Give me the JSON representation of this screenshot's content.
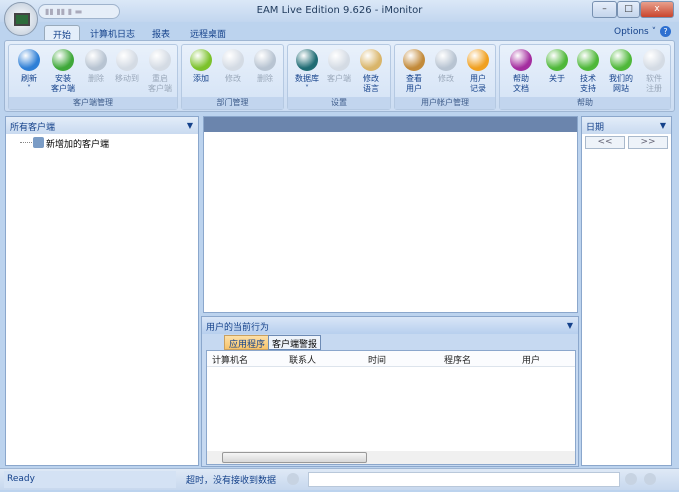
{
  "window": {
    "title": "EAM Live Edition 9.626 - iMonitor",
    "minimize": "–",
    "maximize": "□",
    "close": "x"
  },
  "ribbon": {
    "tabs": [
      "开始",
      "计算机日志",
      "报表",
      "远程桌面"
    ],
    "options": "Options ˅",
    "help_icon": "?",
    "groups": [
      {
        "label": "客户端管理",
        "buttons": [
          {
            "label": "刷新",
            "icon": "refresh-icon",
            "color": "#2e7fd6",
            "enabled": true,
            "dropdown": "˅"
          },
          {
            "label": "安装\n客户端",
            "icon": "install-client-icon",
            "color": "#3fa83a",
            "enabled": true
          },
          {
            "label": "删除",
            "icon": "delete-icon",
            "color": "#b8c4d2",
            "enabled": false
          },
          {
            "label": "移动到",
            "icon": "move-icon",
            "color": "#d4dbe4",
            "enabled": false
          },
          {
            "label": "重启\n客户端",
            "icon": "restart-icon",
            "color": "#d4dbe4",
            "enabled": false
          }
        ]
      },
      {
        "label": "部门管理",
        "buttons": [
          {
            "label": "添加",
            "icon": "add-icon",
            "color": "#7cc22c",
            "enabled": true
          },
          {
            "label": "修改",
            "icon": "edit-icon",
            "color": "#d4dbe4",
            "enabled": false
          },
          {
            "label": "删除",
            "icon": "delete-icon",
            "color": "#b8c4d2",
            "enabled": false
          }
        ]
      },
      {
        "label": "设置",
        "buttons": [
          {
            "label": "数据库",
            "icon": "database-icon",
            "color": "#1f6c74",
            "enabled": true,
            "dropdown": "˅"
          },
          {
            "label": "客户端",
            "icon": "client-icon",
            "color": "#d4dbe4",
            "enabled": false
          },
          {
            "label": "修改\n语言",
            "icon": "language-icon",
            "color": "#d9b56a",
            "enabled": true
          }
        ]
      },
      {
        "label": "用户帐户管理",
        "buttons": [
          {
            "label": "查看\n用户",
            "icon": "users-icon",
            "color": "#c28a3a",
            "enabled": true
          },
          {
            "label": "修改",
            "icon": "user-edit-icon",
            "color": "#b8c4d2",
            "enabled": false
          },
          {
            "label": "用户\n记录",
            "icon": "user-log-icon",
            "color": "#f0a020",
            "enabled": true
          }
        ]
      },
      {
        "label": "帮助",
        "buttons": [
          {
            "label": "帮助\n文档",
            "icon": "help-doc-icon",
            "color": "#a42d9f",
            "enabled": true
          },
          {
            "label": "关于",
            "icon": "about-icon",
            "color": "#4fb83a",
            "enabled": true
          },
          {
            "label": "技术\n支持",
            "icon": "support-icon",
            "color": "#4fb83a",
            "enabled": true
          },
          {
            "label": "我们的\n网站",
            "icon": "website-icon",
            "color": "#4fb83a",
            "enabled": true
          },
          {
            "label": "软件\n注册",
            "icon": "register-icon",
            "color": "#d4dbe4",
            "enabled": false
          }
        ]
      }
    ]
  },
  "left_panel": {
    "title": "所有客户端",
    "tree": [
      {
        "label": "新增加的客户端"
      }
    ]
  },
  "bottom_panel": {
    "title": "用户的当前行为",
    "tabs": [
      "应用程序",
      "客户端警报"
    ],
    "columns": [
      "计算机名",
      "联系人",
      "时间",
      "程序名",
      "用户"
    ]
  },
  "right_panel": {
    "title": "日期",
    "prev": "<<",
    "next": ">>"
  },
  "status": {
    "ready": "Ready",
    "message": "超时，没有接收到数据"
  }
}
